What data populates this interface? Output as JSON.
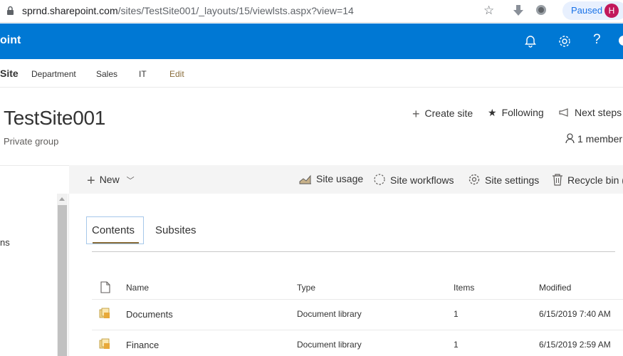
{
  "browser": {
    "url_host": "sprnd.sharepoint.com",
    "url_path": "/sites/TestSite001/_layouts/15/viewlsts.aspx?view=14",
    "paused_label": "Paused",
    "avatar_initial": "H"
  },
  "suite": {
    "title": "oint",
    "help_label": "?"
  },
  "hub_nav": {
    "site_label": "Site",
    "items": [
      "Department",
      "Sales",
      "IT"
    ],
    "edit_label": "Edit"
  },
  "site": {
    "title": "TestSite001",
    "subtitle": "Private group",
    "actions": {
      "create": "Create site",
      "following": "Following",
      "next_steps": "Next steps"
    },
    "members": "1 member"
  },
  "command_bar": {
    "new_label": "New",
    "site_usage": "Site usage",
    "site_workflows": "Site workflows",
    "site_settings": "Site settings",
    "recycle_bin": "Recycle bin ("
  },
  "left_nav": {
    "partial_text": "ns"
  },
  "tabs": {
    "contents": "Contents",
    "subsites": "Subsites"
  },
  "table": {
    "headers": {
      "name": "Name",
      "type": "Type",
      "items": "Items",
      "modified": "Modified"
    },
    "rows": [
      {
        "name": "Documents",
        "type": "Document library",
        "items": "1",
        "modified": "6/15/2019 7:40 AM"
      },
      {
        "name": "Finance",
        "type": "Document library",
        "items": "1",
        "modified": "6/15/2019 2:59 AM"
      }
    ]
  },
  "colors": {
    "suite_bar": "#0078d4",
    "accent_gold": "#8a6d3b",
    "command_bar_bg": "#f4f4f4"
  }
}
